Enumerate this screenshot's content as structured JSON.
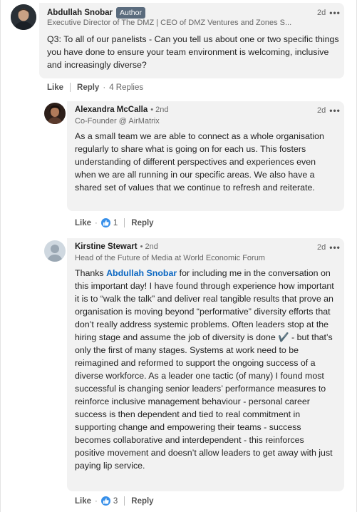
{
  "comments": [
    {
      "author": "Abdullah Snobar",
      "badge": "Author",
      "headline": "Executive Director of The DMZ | CEO of DMZ Ventures and Zones S...",
      "time": "2d",
      "text": "Q3: To all of our panelists - Can you tell us about one or two specific things you have done to ensure your team environment is welcoming, inclusive and increasingly diverse?",
      "actions": {
        "like": "Like",
        "reply": "Reply",
        "replies": "4 Replies"
      }
    }
  ],
  "replies": [
    {
      "author": "Alexandra McCalla",
      "degree": "• 2nd",
      "headline": "Co-Founder @ AirMatrix",
      "time": "2d",
      "text": "As a small team we are able to connect as a whole organisation regularly to share what is going on for each us. This fosters understanding of different perspectives and experiences even when we are all running in our specific areas. We also have a shared set of values that we continue to refresh and reiterate.",
      "actions": {
        "like": "Like",
        "like_count": "1",
        "reply": "Reply"
      }
    },
    {
      "author": "Kirstine Stewart",
      "degree": "• 2nd",
      "headline": "Head of the Future of Media at World Economic Forum",
      "time": "2d",
      "text_prefix": "Thanks ",
      "mention": "Abdullah Snobar",
      "text_rest": " for including me in the conversation on this important day! I have found through experience how important it is to “walk the talk” and deliver real tangible results that prove an organisation is moving beyond “performative” diversity efforts that don’t really address systemic problems. Often leaders stop at the hiring stage and assume the job of diversity is done ✔️ - but that’s only the first of many stages. Systems at work need to be reimagined and reformed to support the ongoing success of a diverse workforce. As a leader one tactic (of many) I found most successful is changing senior leaders’ performance measures to reinforce inclusive management behaviour - personal career success is then dependent and tied to real commitment in supporting change and empowering their teams - success becomes collaborative and interdependent - this reinforces positive movement and doesn’t allow leaders to get away with just paying lip service.",
      "actions": {
        "like": "Like",
        "like_count": "3",
        "reply": "Reply"
      }
    }
  ],
  "colors": {
    "bubble": "#f2f2f2",
    "mention": "#0a66c2",
    "badge": "#5a6b7d",
    "like": "#378fe9"
  },
  "icons": [
    "more-options-icon",
    "like-reaction-icon"
  ]
}
